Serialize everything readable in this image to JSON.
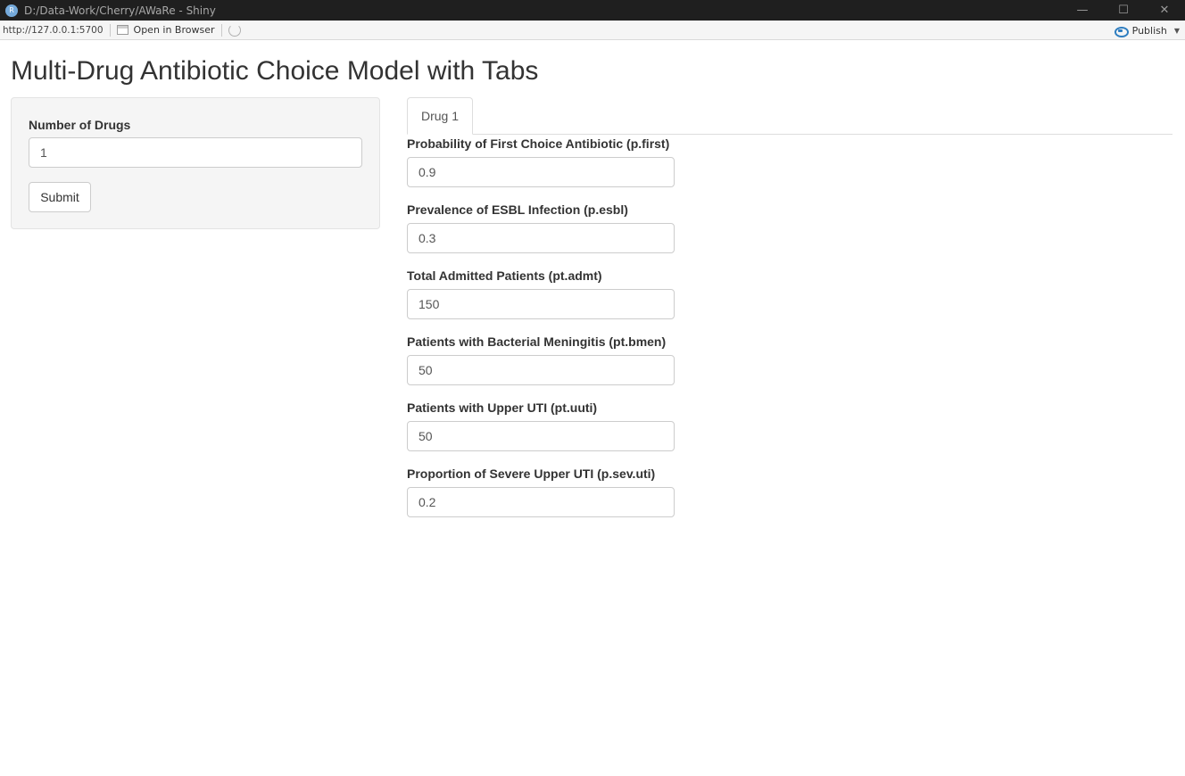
{
  "window": {
    "title": "D:/Data-Work/Cherry/AWaRe - Shiny",
    "app_icon_letter": "R",
    "controls": {
      "minimize": "—",
      "maximize": "☐",
      "close": "✕"
    }
  },
  "toolbar": {
    "url": "http://127.0.0.1:5700",
    "open_in_browser_label": "Open in Browser",
    "publish_label": "Publish",
    "publish_caret": "▼"
  },
  "page": {
    "title": "Multi-Drug Antibiotic Choice Model with Tabs"
  },
  "sidebar": {
    "num_drugs_label": "Number of Drugs",
    "num_drugs_value": "1",
    "submit_label": "Submit"
  },
  "tabs": [
    {
      "label": "Drug 1",
      "active": true
    }
  ],
  "fields": [
    {
      "label": "Probability of First Choice Antibiotic (p.first)",
      "value": "0.9"
    },
    {
      "label": "Prevalence of ESBL Infection (p.esbl)",
      "value": "0.3"
    },
    {
      "label": "Total Admitted Patients (pt.admt)",
      "value": "150"
    },
    {
      "label": "Patients with Bacterial Meningitis (pt.bmen)",
      "value": "50"
    },
    {
      "label": "Patients with Upper UTI (pt.uuti)",
      "value": "50"
    },
    {
      "label": "Proportion of Severe Upper UTI (p.sev.uti)",
      "value": "0.2"
    }
  ],
  "icons": {
    "app": "r-logo-icon",
    "open_in_browser": "browser-window-icon",
    "refresh": "refresh-icon",
    "publish": "publish-icon"
  },
  "colors": {
    "titlebar": "#1f1f1f",
    "toolbar": "#f5f5f5",
    "publish_accent": "#2f7ec0",
    "sidebar_panel": "#f5f5f5",
    "input_border": "#cccccc"
  }
}
